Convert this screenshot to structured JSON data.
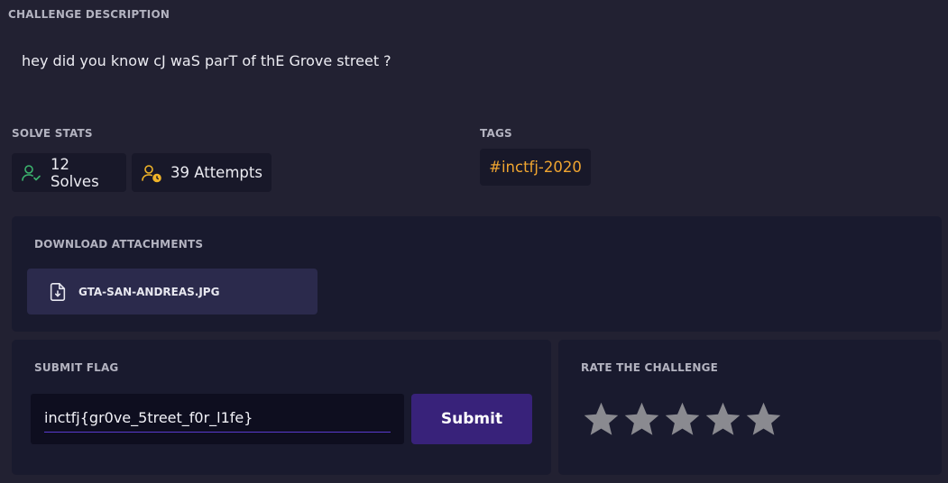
{
  "challenge": {
    "title": "CHALLENGE DESCRIPTION",
    "description": "hey did you know cJ waS parT of thE Grove street ?"
  },
  "stats": {
    "title": "SOLVE STATS",
    "solves_label": "12 Solves",
    "attempts_label": "39 Attempts",
    "solves_icon": "user-check-icon",
    "attempts_icon": "user-clock-icon"
  },
  "tags": {
    "title": "TAGS",
    "items": [
      "#inctfj-2020"
    ]
  },
  "download": {
    "title": "DOWNLOAD ATTACHMENTS",
    "file_name": "GTA-SAN-ANDREAS.JPG",
    "icon": "file-download-icon"
  },
  "submit": {
    "title": "SUBMIT FLAG",
    "flag_value": "inctfj{gr0ve_5treet_f0r_l1fe}",
    "button_label": "Submit"
  },
  "rating": {
    "title": "RATE THE CHALLENGE",
    "max_stars": 5,
    "current_rating": 0
  },
  "colors": {
    "background": "#222132",
    "panel": "#191a2e",
    "chip": "#181829",
    "tag_text": "#f0a530",
    "solves_icon": "#3cb46e",
    "attempts_icon": "#f0b428",
    "submit_button": "#38227a",
    "attach_button": "#2b2a4c",
    "star": "#8a8a90"
  }
}
